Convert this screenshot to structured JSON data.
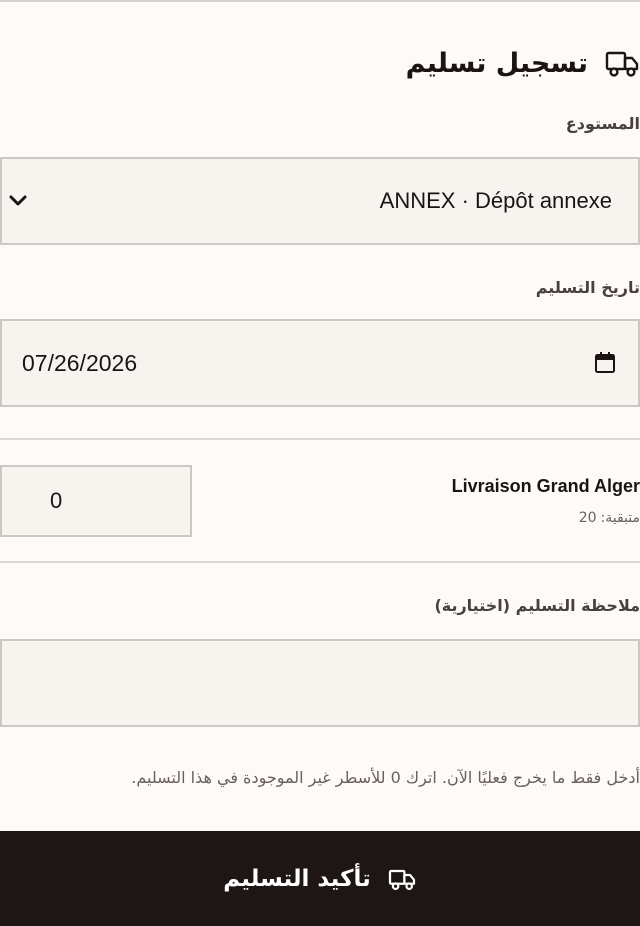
{
  "header": {
    "title": "تسجيل تسليم",
    "icon": "truck-icon"
  },
  "warehouse": {
    "label": "المستودع",
    "selected": "ANNEX · Dépôt annexe"
  },
  "delivery_date": {
    "label": "تاريخ التسليم",
    "value": "07/26/2026"
  },
  "line": {
    "product": "Livraison Grand Alger",
    "remaining_label": "متبقية:",
    "remaining_value": "20",
    "quantity": "0"
  },
  "note": {
    "label": "ملاحظة التسليم (اختيارية)",
    "value": ""
  },
  "hint": "أدخل فقط ما يخرج فعليًا الآن. اترك 0 للأسطر غير الموجودة في هذا التسليم.",
  "confirm": {
    "label": "تأكيد التسليم",
    "icon": "truck-icon"
  },
  "colors": {
    "background": "#fdfaf8",
    "field": "#f7f4ef",
    "border": "#cfc7c4",
    "button": "#1e1614",
    "text": "#1c1412"
  }
}
